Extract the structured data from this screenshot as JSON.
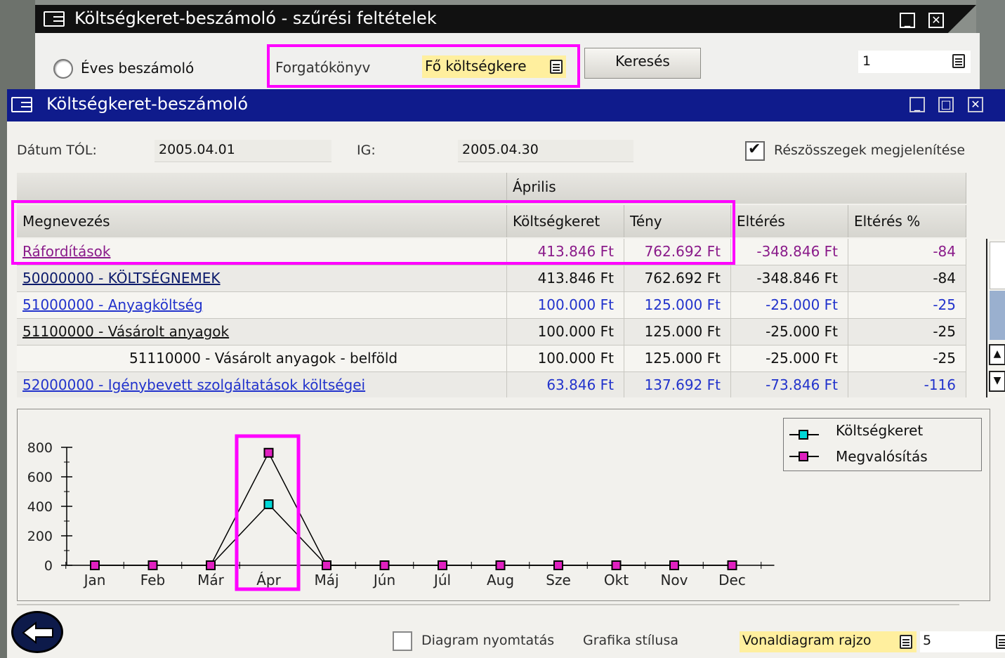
{
  "back_window": {
    "title": "Költségkeret-beszámoló - szűrési feltételek",
    "radio_label": "Éves beszámoló",
    "scenario_label": "Forgatókönyv",
    "scenario_value": "Fő költségkere",
    "search_button": "Keresés",
    "field_value": "1"
  },
  "main_window": {
    "title": "Költségkeret-beszámoló",
    "date_from_label": "Dátum TÓL:",
    "date_from_value": "2005.04.01",
    "date_to_label": "IG:",
    "date_to_value": "2005.04.30",
    "subtotals_label": "Részösszegek megjelenítése",
    "subtotals_checked": true
  },
  "table": {
    "group_header": "Április",
    "columns": [
      "Megnevezés",
      "Költségkeret",
      "Tény",
      "Eltérés",
      "Eltérés %"
    ],
    "rows": [
      {
        "name": "Ráfordítások",
        "budget": "413.846 Ft",
        "actual": "762.692 Ft",
        "diff": "-348.846 Ft",
        "pct": "-84"
      },
      {
        "name": "50000000 - KÖLTSÉGNEMEK",
        "budget": "413.846 Ft",
        "actual": "762.692 Ft",
        "diff": "-348.846 Ft",
        "pct": "-84"
      },
      {
        "name": "51000000 - Anyagköltség",
        "budget": "100.000 Ft",
        "actual": "125.000 Ft",
        "diff": "-25.000 Ft",
        "pct": "-25"
      },
      {
        "name": "51100000 - Vásárolt anyagok",
        "budget": "100.000 Ft",
        "actual": "125.000 Ft",
        "diff": "-25.000 Ft",
        "pct": "-25"
      },
      {
        "name": "51110000 - Vásárolt anyagok - belföld",
        "budget": "100.000 Ft",
        "actual": "125.000 Ft",
        "diff": "-25.000 Ft",
        "pct": "-25"
      },
      {
        "name": "52000000 - Igénybevett szolgáltatások költségei",
        "budget": "63.846 Ft",
        "actual": "137.692 Ft",
        "diff": "-73.846 Ft",
        "pct": "-116"
      }
    ]
  },
  "chart_data": {
    "type": "line",
    "categories": [
      "Jan",
      "Feb",
      "Már",
      "Ápr",
      "Máj",
      "Jún",
      "Júl",
      "Aug",
      "Sze",
      "Okt",
      "Nov",
      "Dec"
    ],
    "series": [
      {
        "name": "Költségkeret",
        "color": "#00d8d8",
        "values": [
          0,
          0,
          0,
          414,
          0,
          0,
          0,
          0,
          0,
          0,
          0,
          0
        ]
      },
      {
        "name": "Megvalósítás",
        "color": "#e020c0",
        "values": [
          0,
          0,
          0,
          763,
          0,
          0,
          0,
          0,
          0,
          0,
          0,
          0
        ]
      }
    ],
    "yticks": [
      0,
      200,
      400,
      600,
      800
    ],
    "ylim": [
      0,
      800
    ],
    "legend": "top-right"
  },
  "footer": {
    "print_label": "Diagram nyomtatás",
    "style_label": "Grafika stílusa",
    "style_value": "Vonaldiagram rajzo",
    "count_value": "5"
  }
}
